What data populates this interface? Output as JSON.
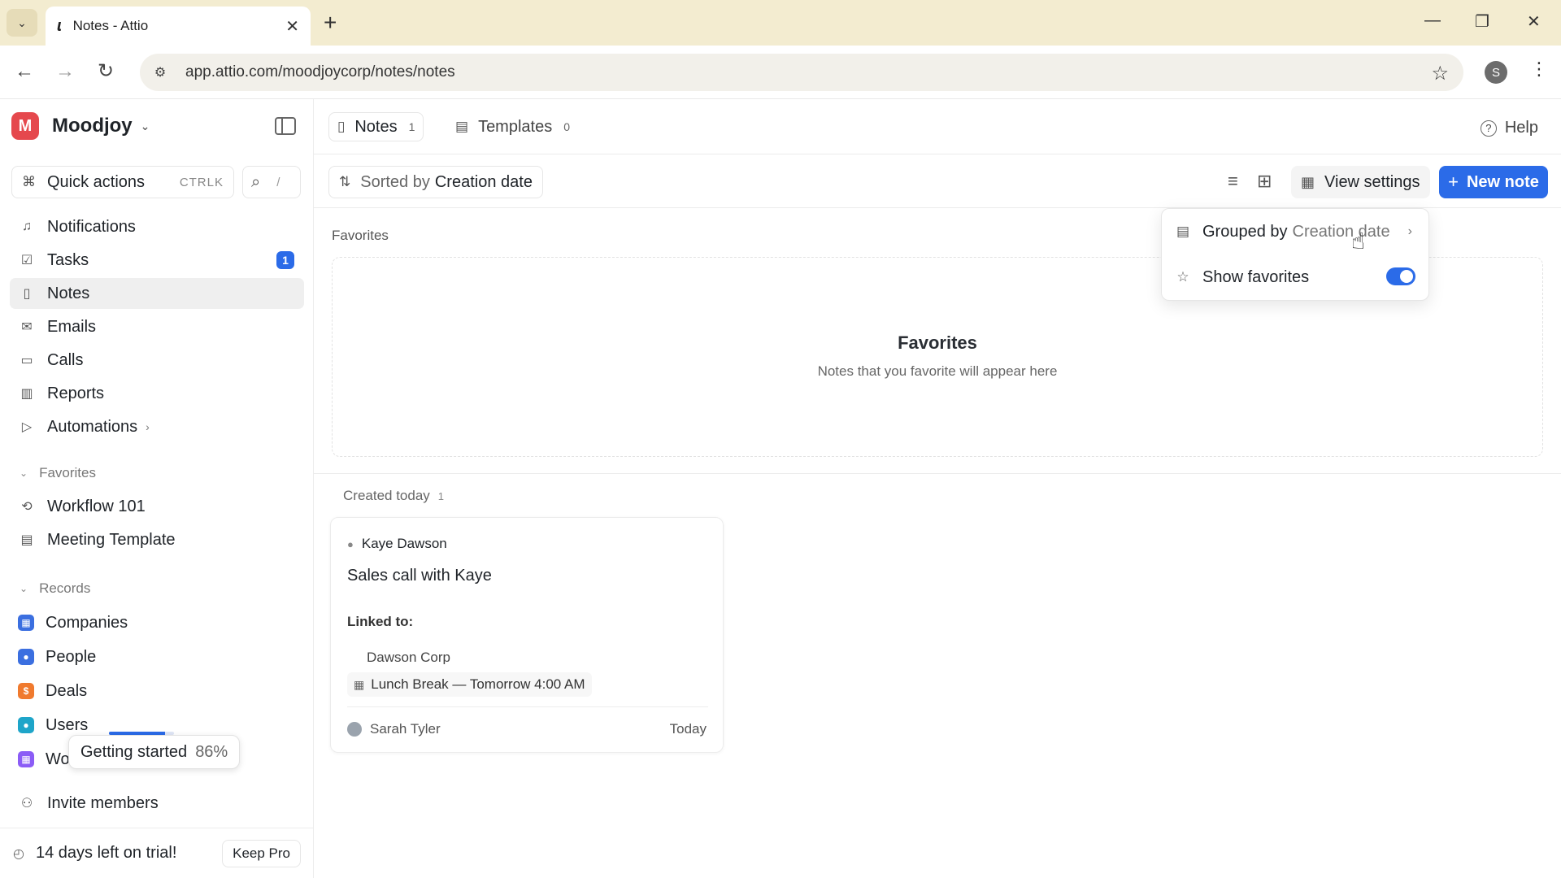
{
  "browser": {
    "tab_title": "Notes - Attio",
    "url": "app.attio.com/moodjoycorp/notes/notes",
    "profile_initial": "S"
  },
  "sidebar": {
    "workspace": "Moodjoy",
    "workspace_initial": "M",
    "quick_actions": {
      "label": "Quick actions",
      "shortcut": "CTRLK"
    },
    "search_shortcut": "/",
    "nav": [
      {
        "label": "Notifications",
        "icon": "bell-icon"
      },
      {
        "label": "Tasks",
        "icon": "check-square-icon",
        "badge": "1"
      },
      {
        "label": "Notes",
        "icon": "file-icon",
        "active": true
      },
      {
        "label": "Emails",
        "icon": "mail-icon"
      },
      {
        "label": "Calls",
        "icon": "video-icon"
      },
      {
        "label": "Reports",
        "icon": "bar-chart-icon"
      },
      {
        "label": "Automations",
        "icon": "play-icon"
      }
    ],
    "favorites_header": "Favorites",
    "favorites": [
      {
        "label": "Workflow 101",
        "icon": "workflow-icon"
      },
      {
        "label": "Meeting Template",
        "icon": "template-icon"
      }
    ],
    "records_header": "Records",
    "records": [
      {
        "label": "Companies",
        "color": "#3b6fe0"
      },
      {
        "label": "People",
        "color": "#3b6fe0"
      },
      {
        "label": "Deals",
        "color": "#f07a2e"
      },
      {
        "label": "Users",
        "color": "#1ea5c9"
      },
      {
        "label": "Wor",
        "color": "#8b5cf6"
      }
    ],
    "getting_started": {
      "label": "Getting started",
      "percent_label": "86%",
      "progress": 0.86
    },
    "invite": "Invite members",
    "trial": {
      "label": "14 days left on trial!",
      "button": "Keep Pro"
    }
  },
  "main": {
    "tabs": [
      {
        "label": "Notes",
        "count": "1"
      },
      {
        "label": "Templates",
        "count": "0"
      }
    ],
    "help": "Help",
    "sort": {
      "prefix": "Sorted by",
      "value": "Creation date"
    },
    "view_settings": "View settings",
    "new_note": "New note",
    "favorites_label": "Favorites",
    "favorites_empty": {
      "title": "Favorites",
      "subtitle": "Notes that you favorite will appear here"
    },
    "group": {
      "label": "Created today",
      "count": "1"
    },
    "note": {
      "person": "Kaye Dawson",
      "title": "Sales call with Kaye",
      "linked_label": "Linked to:",
      "linked_item": "Dawson Corp",
      "event": "Lunch Break — Tomorrow 4:00 AM",
      "author": "Sarah Tyler",
      "date": "Today"
    },
    "menu": {
      "grouped": {
        "prefix": "Grouped by",
        "value": "Creation date"
      },
      "show_favorites": {
        "label": "Show favorites",
        "enabled": true
      }
    }
  },
  "colors": {
    "accent": "#2b6be8",
    "workspace_logo": "#e5484d"
  }
}
